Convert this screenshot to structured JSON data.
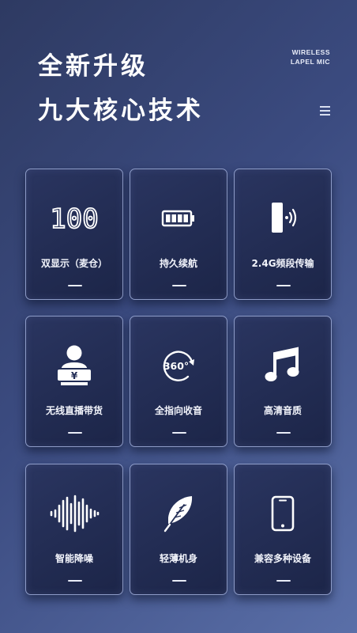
{
  "header": {
    "title_line1": "全新升级",
    "title_line2": "九大核心技术",
    "brand_line1": "WIRELESS",
    "brand_line2": "LAPEL MIC"
  },
  "features": [
    {
      "label": "双显示（麦仓）",
      "icon": "digital-display-icon",
      "display_text": "100"
    },
    {
      "label": "持久续航",
      "icon": "battery-icon"
    },
    {
      "label": "2.4G频段传输",
      "icon": "wireless-transmitter-icon"
    },
    {
      "label": "无线直播带货",
      "icon": "livestream-seller-icon",
      "badge_text": "¥"
    },
    {
      "label": "全指向收音",
      "icon": "360-pickup-icon",
      "badge_text": "360°"
    },
    {
      "label": "高清音质",
      "icon": "music-note-icon"
    },
    {
      "label": "智能降噪",
      "icon": "soundwave-icon"
    },
    {
      "label": "轻薄机身",
      "icon": "feather-icon"
    },
    {
      "label": "兼容多种设备",
      "icon": "smartphone-icon"
    }
  ]
}
